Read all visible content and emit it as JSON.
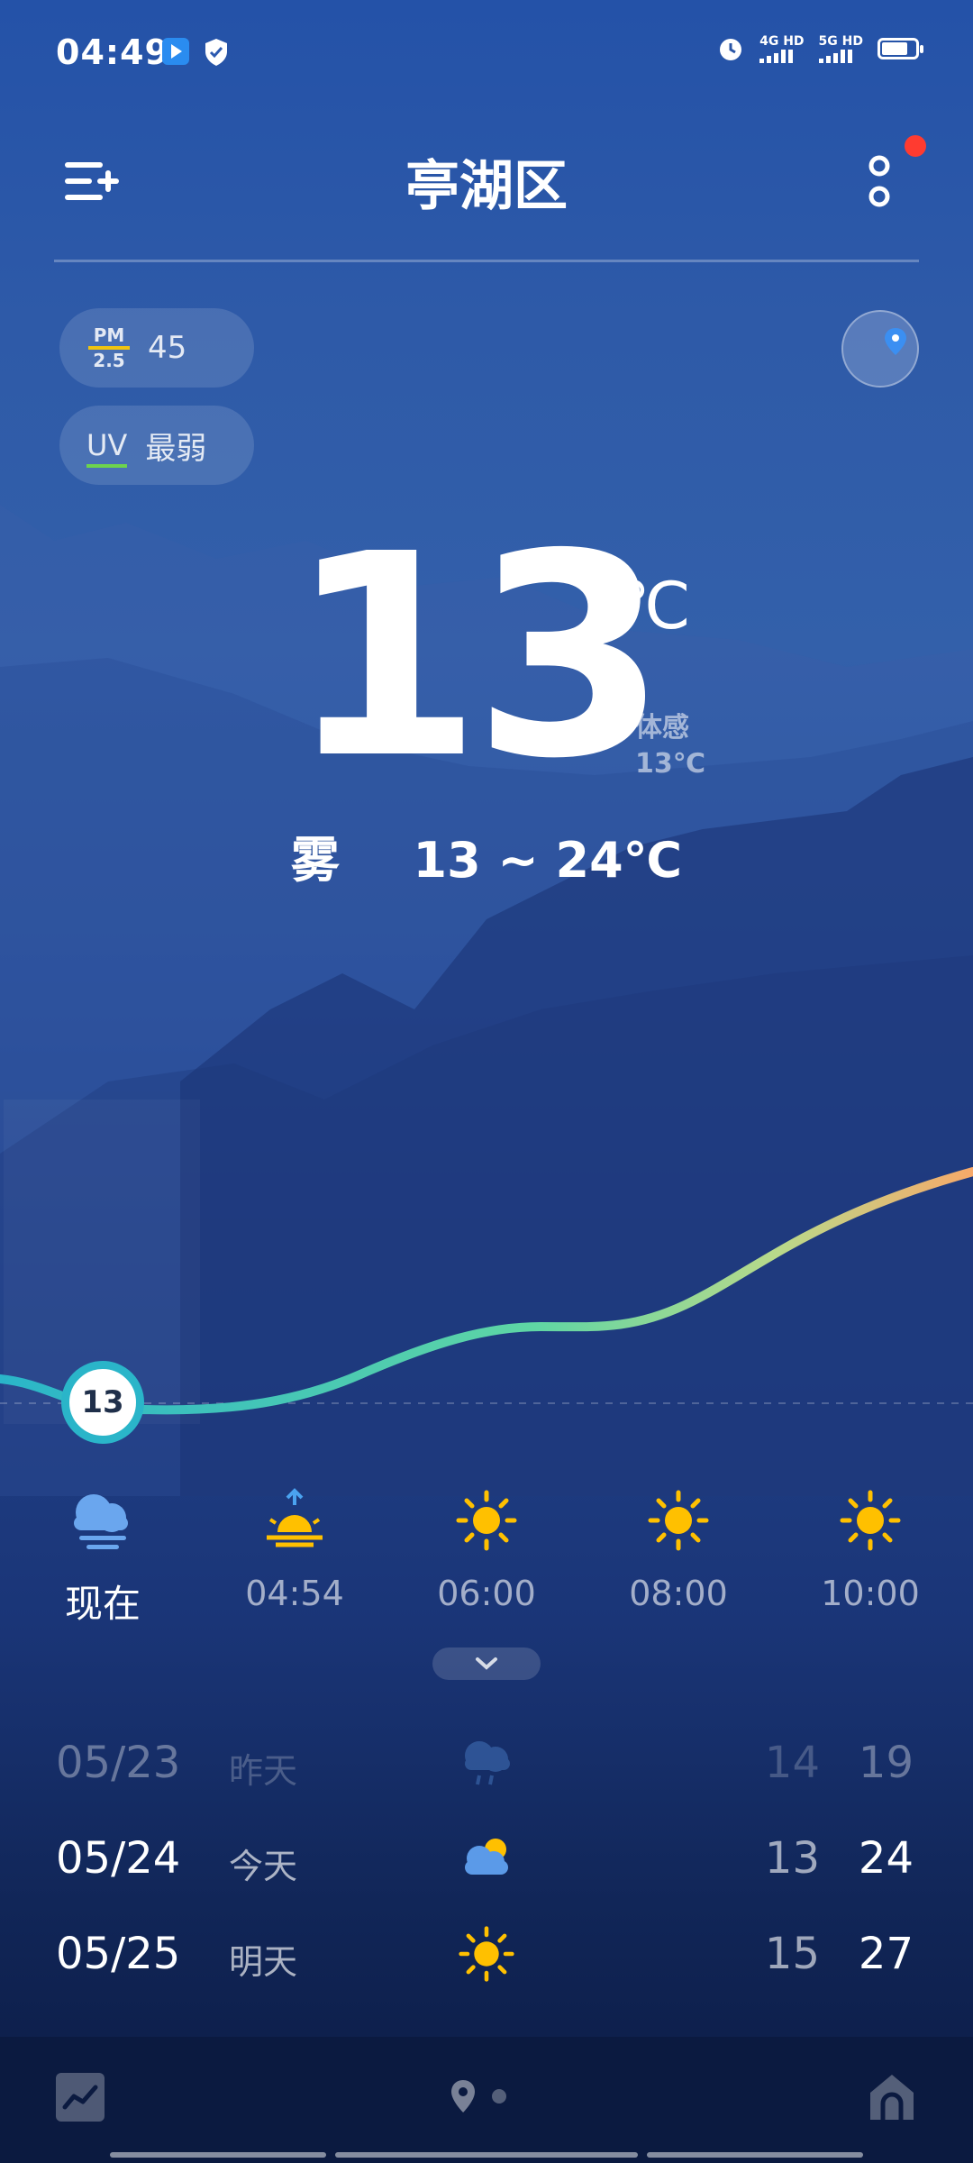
{
  "status_bar": {
    "time": "04:49",
    "net1": "4G HD",
    "net2": "5G HD"
  },
  "header": {
    "title": "亭湖区",
    "menu_icon": "add-city-icon",
    "more_icon": "more-icon"
  },
  "air": {
    "pm_label_top": "PM",
    "pm_label_bottom": "2.5",
    "pm_value": "45",
    "uv_label": "UV",
    "uv_value": "最弱"
  },
  "current": {
    "temp": "13",
    "unit": "℃",
    "feels_label": "体感",
    "feels_value": "13℃",
    "condition": "雾",
    "range": "13 ~ 24℃"
  },
  "hourly": {
    "now_temp": "13",
    "items": [
      {
        "label": "现在",
        "icon": "fog-cloud-icon"
      },
      {
        "label": "04:54",
        "icon": "sunrise-icon"
      },
      {
        "label": "06:00",
        "icon": "sun-icon"
      },
      {
        "label": "08:00",
        "icon": "sun-icon"
      },
      {
        "label": "10:00",
        "icon": "sun-icon"
      }
    ]
  },
  "daily": [
    {
      "date": "05/23",
      "rel": "昨天",
      "icon": "rain-icon",
      "lo": "14",
      "hi": "19"
    },
    {
      "date": "05/24",
      "rel": "今天",
      "icon": "partly-cloudy-icon",
      "lo": "13",
      "hi": "24"
    },
    {
      "date": "05/25",
      "rel": "明天",
      "icon": "sun-icon",
      "lo": "15",
      "hi": "27"
    }
  ],
  "colors": {
    "curve_start": "#2ab5c9",
    "curve_mid": "#5fd6a4",
    "curve_end": "#f7a969",
    "sun": "#ffc000",
    "pm_line": "#f1c40f",
    "uv_line": "#6dd44c"
  }
}
